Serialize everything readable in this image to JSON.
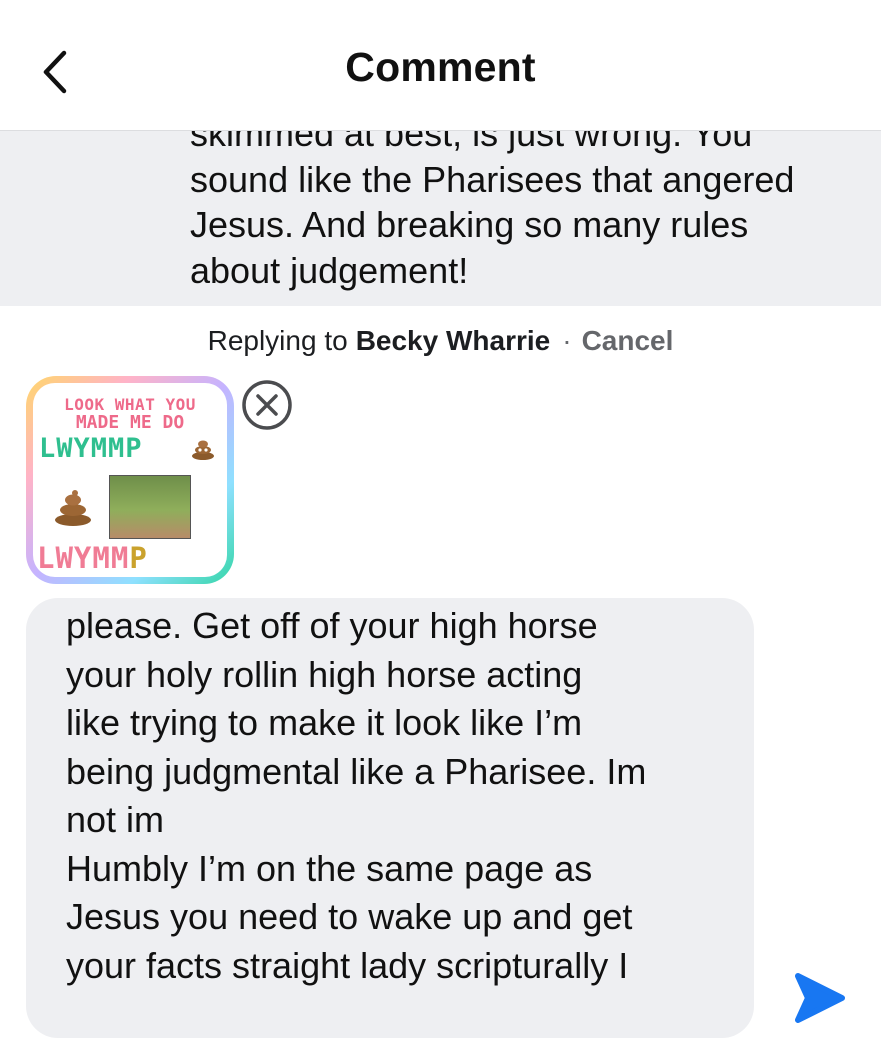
{
  "header": {
    "title": "Comment",
    "back_icon": "chevron-left-icon"
  },
  "parent_comment": {
    "text": "skimmed at best, is just wrong. You\nsound like the Pharisees that angered\nJesus. And breaking so many rules\nabout judgement!"
  },
  "reply_bar": {
    "prefix": "Replying to",
    "name": "Becky Wharrie",
    "separator": "·",
    "cancel": "Cancel"
  },
  "sticker": {
    "line1": "LOOK WHAT YOU",
    "line2": "MADE ME DO",
    "line3": "LWYMMP",
    "line4_a": "LWYMM",
    "line4_b": "P",
    "remove_icon": "close-circle-icon"
  },
  "composer": {
    "text": "please. Get off of your high horse\nyour holy rollin high horse acting\nlike trying to make it look like I’m\nbeing judgmental like a Pharisee. Im\nnot im\nHumbly I’m on the same page as\nJesus you need to wake up and get\nyour facts straight lady scripturally I",
    "send_icon": "send-icon"
  },
  "colors": {
    "accent": "#1877f2",
    "bubble_bg": "#eeeff2",
    "muted_text": "#65676b"
  }
}
